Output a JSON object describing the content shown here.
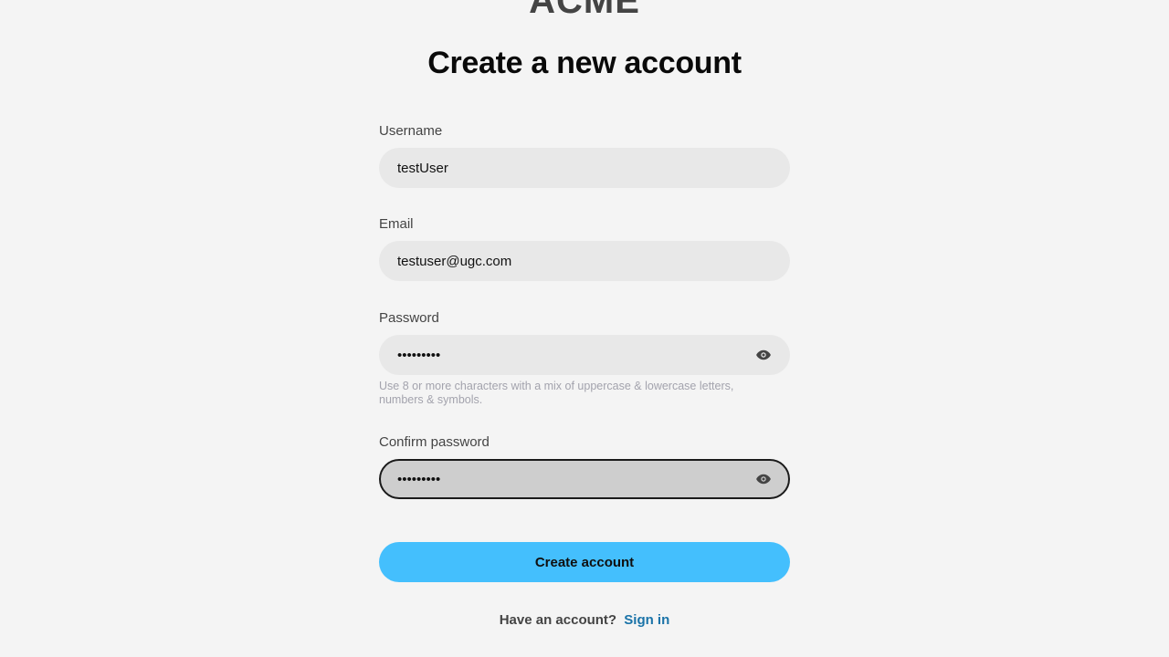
{
  "brand": {
    "logo_text": "ACME"
  },
  "page": {
    "title": "Create a new account"
  },
  "form": {
    "username": {
      "label": "Username",
      "value": "testUser"
    },
    "email": {
      "label": "Email",
      "value": "testuser@ugc.com"
    },
    "password": {
      "label": "Password",
      "value": "•••••••••",
      "hint": "Use 8 or more characters with a mix of uppercase & lowercase letters, numbers & symbols."
    },
    "confirm_password": {
      "label": "Confirm password",
      "value": "•••••••••"
    },
    "submit_label": "Create account"
  },
  "footer": {
    "prompt": "Have an account?",
    "signin_link": "Sign in"
  },
  "icons": {
    "password_toggle": "eye-icon",
    "confirm_toggle": "eye-icon"
  },
  "colors": {
    "background": "#f4f4f4",
    "input_background": "#e8e8e8",
    "focused_input_background": "#cecece",
    "primary_button": "#44bffd",
    "link": "#1a73a8",
    "hint_text": "#a3a3ad"
  }
}
